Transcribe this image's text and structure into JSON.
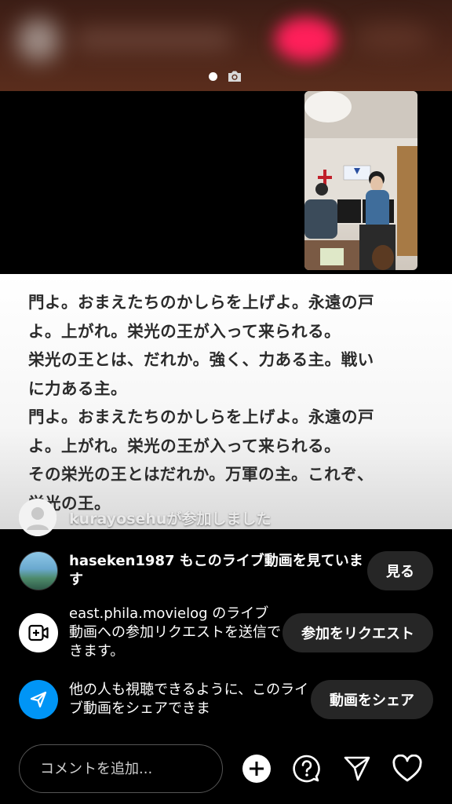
{
  "header": {
    "page_indicator": {
      "active_dot": "dot",
      "camera_icon": "camera-icon"
    }
  },
  "lyrics": {
    "lines": [
      "門よ。おまえたちのかしらを上げよ。永遠の戸",
      "よ。上がれ。栄光の王が入って来られる。",
      "栄光の王とは、だれか。強く、力ある主。戦い",
      "に力ある主。",
      "門よ。おまえたちのかしらを上げよ。永遠の戸",
      "よ。上がれ。栄光の王が入って来られる。",
      "その栄光の王とはだれか。万軍の主。これぞ、",
      "栄光の王。"
    ]
  },
  "join_notice": {
    "text": "kurayosehuが参加しました"
  },
  "viewer_row": {
    "message": "haseken1987 もこのライブ動画を見ています",
    "button_label": "見る"
  },
  "request_row": {
    "message": "east.phila.movielog のライブ動画への参加リクエストを送信できます。",
    "button_label": "参加をリクエスト",
    "icon": "add-video-icon"
  },
  "share_row": {
    "message": "他の人も視聴できるように、このライブ動画をシェアできま",
    "button_label": "動画をシェア",
    "icon": "paper-plane-icon"
  },
  "bottom_bar": {
    "comment_placeholder": "コメントを追加...",
    "icons": [
      "plus-icon",
      "question-icon",
      "send-icon",
      "heart-icon"
    ]
  },
  "colors": {
    "accent_blue": "#0095f6",
    "pill_bg": "#262626",
    "live_pink": "#ff1f5a"
  }
}
